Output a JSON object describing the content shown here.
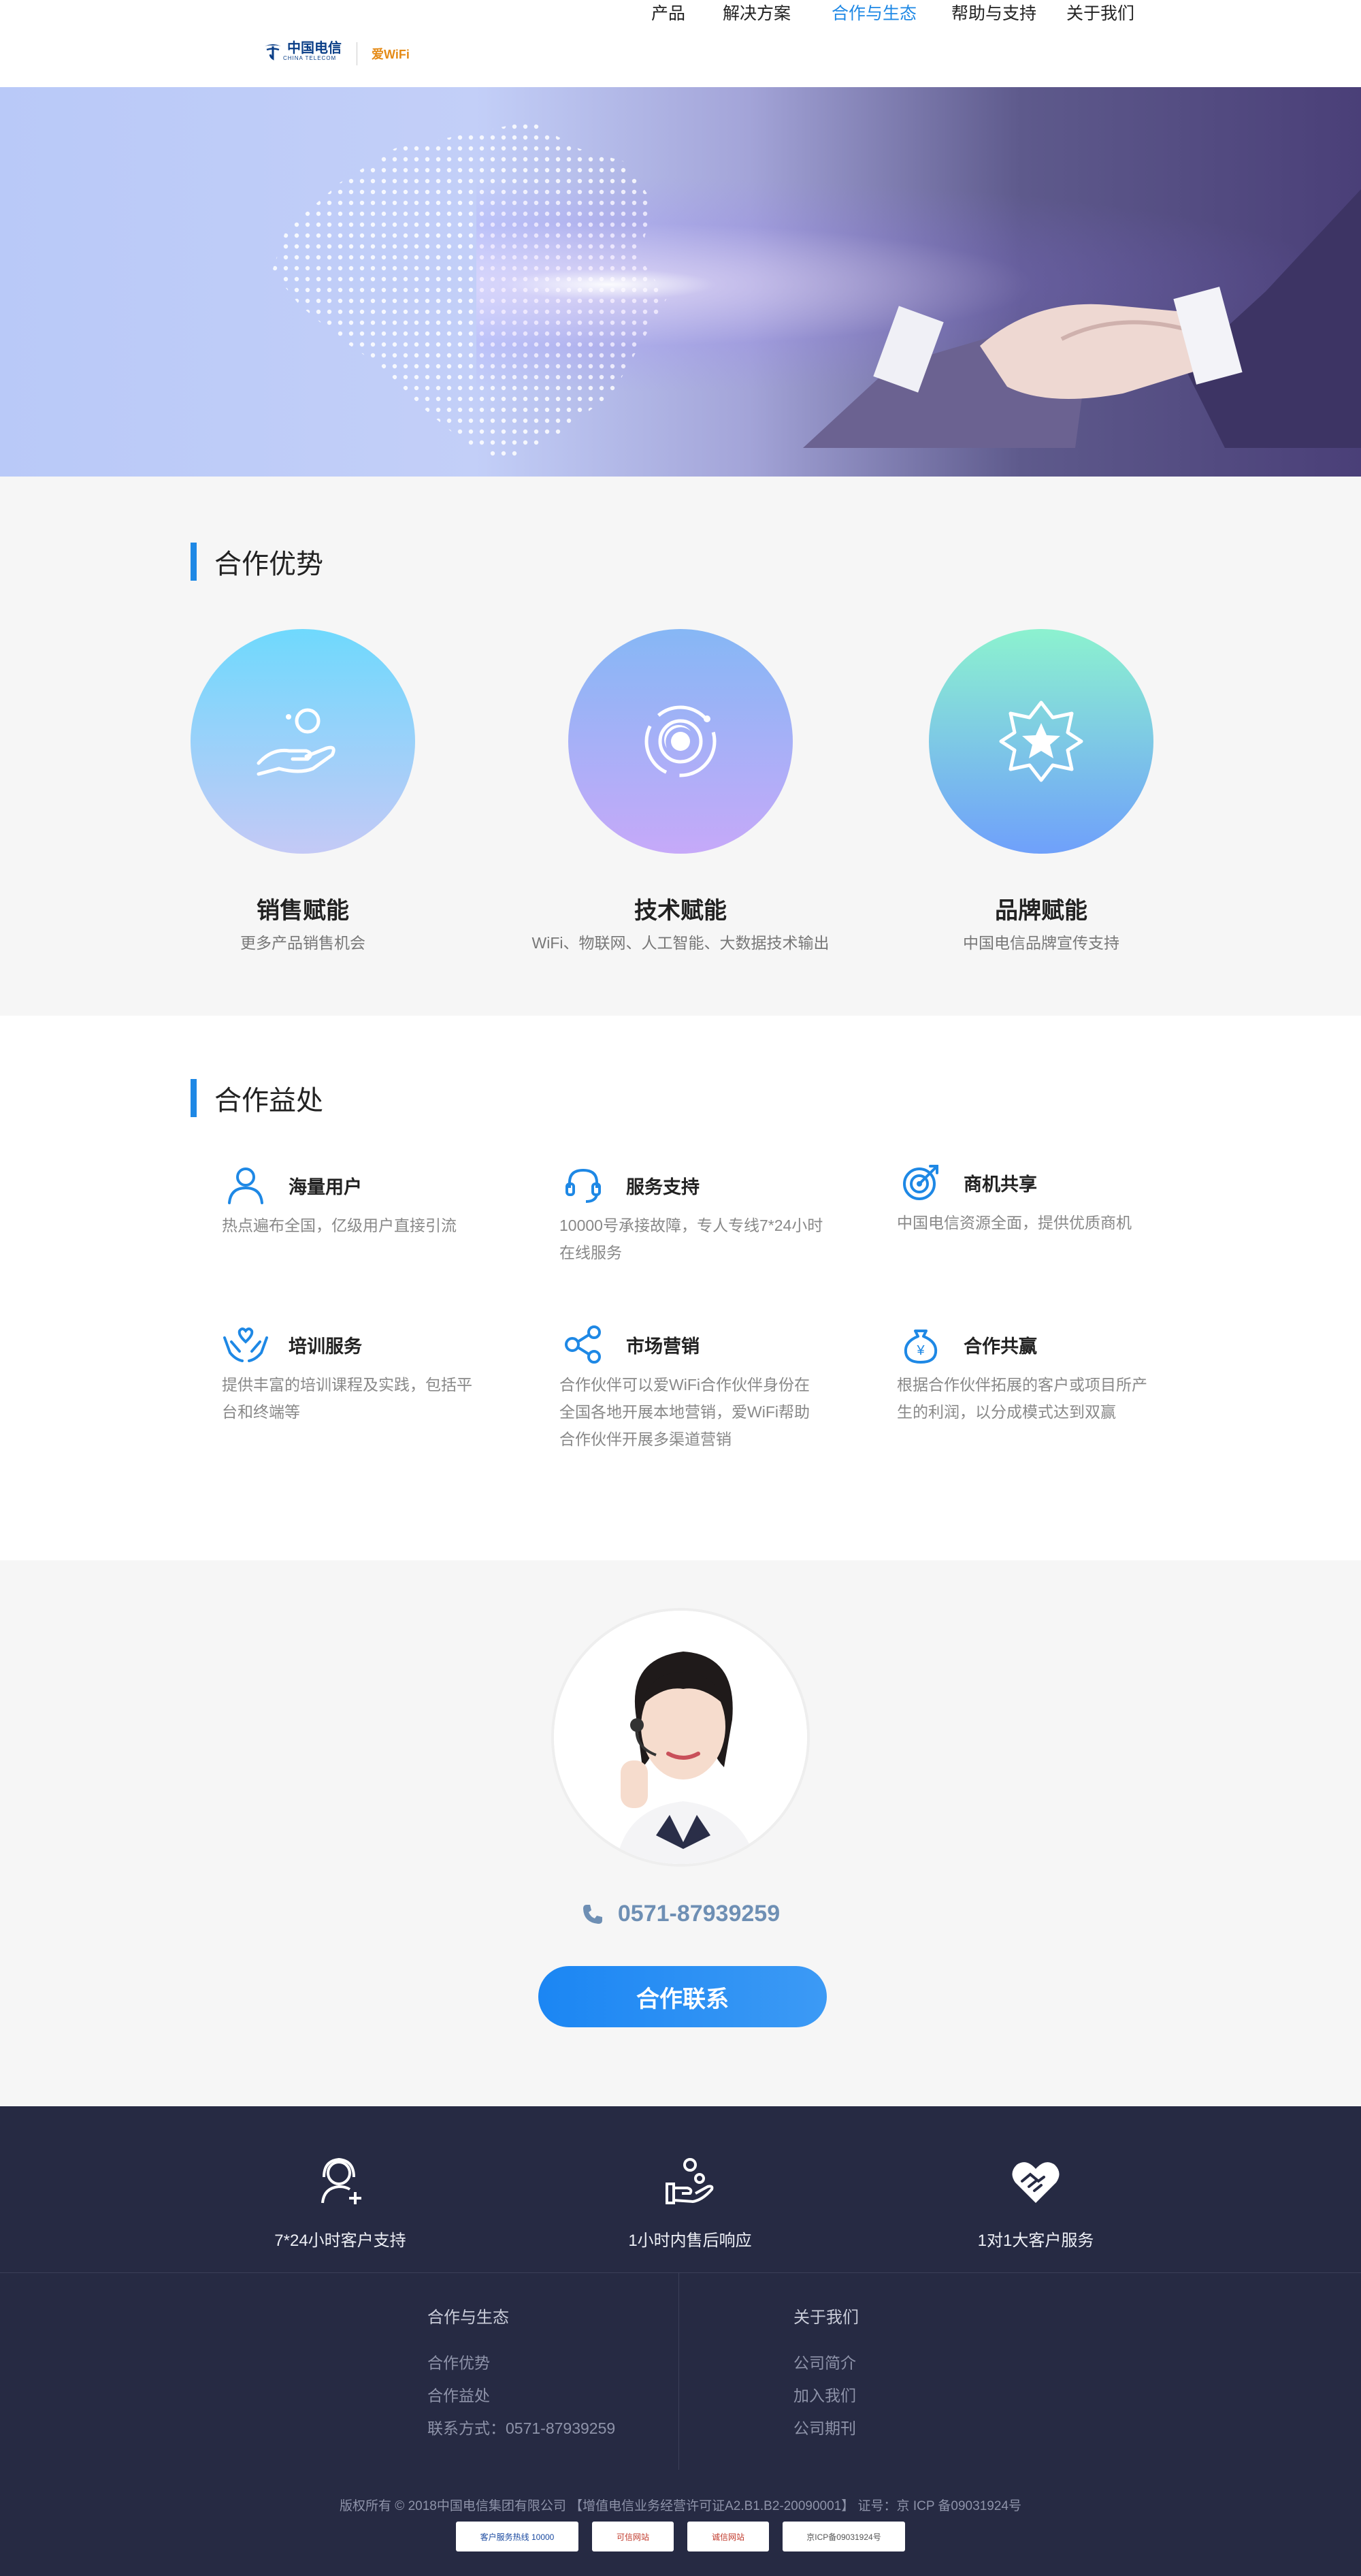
{
  "header": {
    "brand_cn": "中国电信",
    "brand_en": "CHINA TELECOM",
    "wifi_brand": "爱WiFi",
    "nav": [
      {
        "label": "产品"
      },
      {
        "label": "解决方案"
      },
      {
        "label": "合作与生态"
      },
      {
        "label": "帮助与支持"
      },
      {
        "label": "关于我们"
      }
    ]
  },
  "advantages": {
    "title": "合作优势",
    "items": [
      {
        "name": "销售赋能",
        "desc": "更多产品销售机会",
        "icon": "hand-coin-icon"
      },
      {
        "name": "技术赋能",
        "desc": "WiFi、物联网、人工智能、大数据技术输出",
        "icon": "orbit-icon"
      },
      {
        "name": "品牌赋能",
        "desc": "中国电信品牌宣传支持",
        "icon": "star-badge-icon"
      }
    ]
  },
  "benefits": {
    "title": "合作益处",
    "items": [
      {
        "name": "海量用户",
        "desc": "热点遍布全国，亿级用户直接引流",
        "icon": "user-icon"
      },
      {
        "name": "服务支持",
        "desc": "10000号承接故障，专人专线7*24小时在线服务",
        "icon": "headset-icon"
      },
      {
        "name": "商机共享",
        "desc": "中国电信资源全面，提供优质商机",
        "icon": "target-icon"
      },
      {
        "name": "培训服务",
        "desc": "提供丰富的培训课程及实践，包括平台和终端等",
        "icon": "hands-heart-icon"
      },
      {
        "name": "市场营销",
        "desc": "合作伙伴可以爱WiFi合作伙伴身份在全国各地开展本地营销，爱WiFi帮助合作伙伴开展多渠道营销",
        "icon": "share-icon"
      },
      {
        "name": "合作共赢",
        "desc": "根据合作伙伴拓展的客户或项目所产生的利润，以分成模式达到双赢",
        "icon": "money-bag-icon"
      }
    ]
  },
  "contact": {
    "phone": "0571-87939259",
    "button": "合作联系"
  },
  "footer": {
    "features": [
      {
        "label": "7*24小时客户支持",
        "icon": "support-icon"
      },
      {
        "label": "1小时内售后响应",
        "icon": "hand-service-icon"
      },
      {
        "label": "1对1大客户服务",
        "icon": "handshake-heart-icon"
      }
    ],
    "col1": {
      "heading": "合作与生态",
      "links": [
        "合作优势",
        "合作益处",
        "联系方式：0571-87939259"
      ]
    },
    "col2": {
      "heading": "关于我们",
      "links": [
        "公司简介",
        "加入我们",
        "公司期刊"
      ]
    },
    "copyright": "版权所有 © 2018中国电信集团有限公司 【增值电信业务经营许可证A2.B1.B2-20090001】 证号：京 ICP 备09031924号",
    "badges": [
      "客户服务热线 10000",
      "可信网站",
      "诚信网站",
      "京ICP备09031924号"
    ]
  }
}
